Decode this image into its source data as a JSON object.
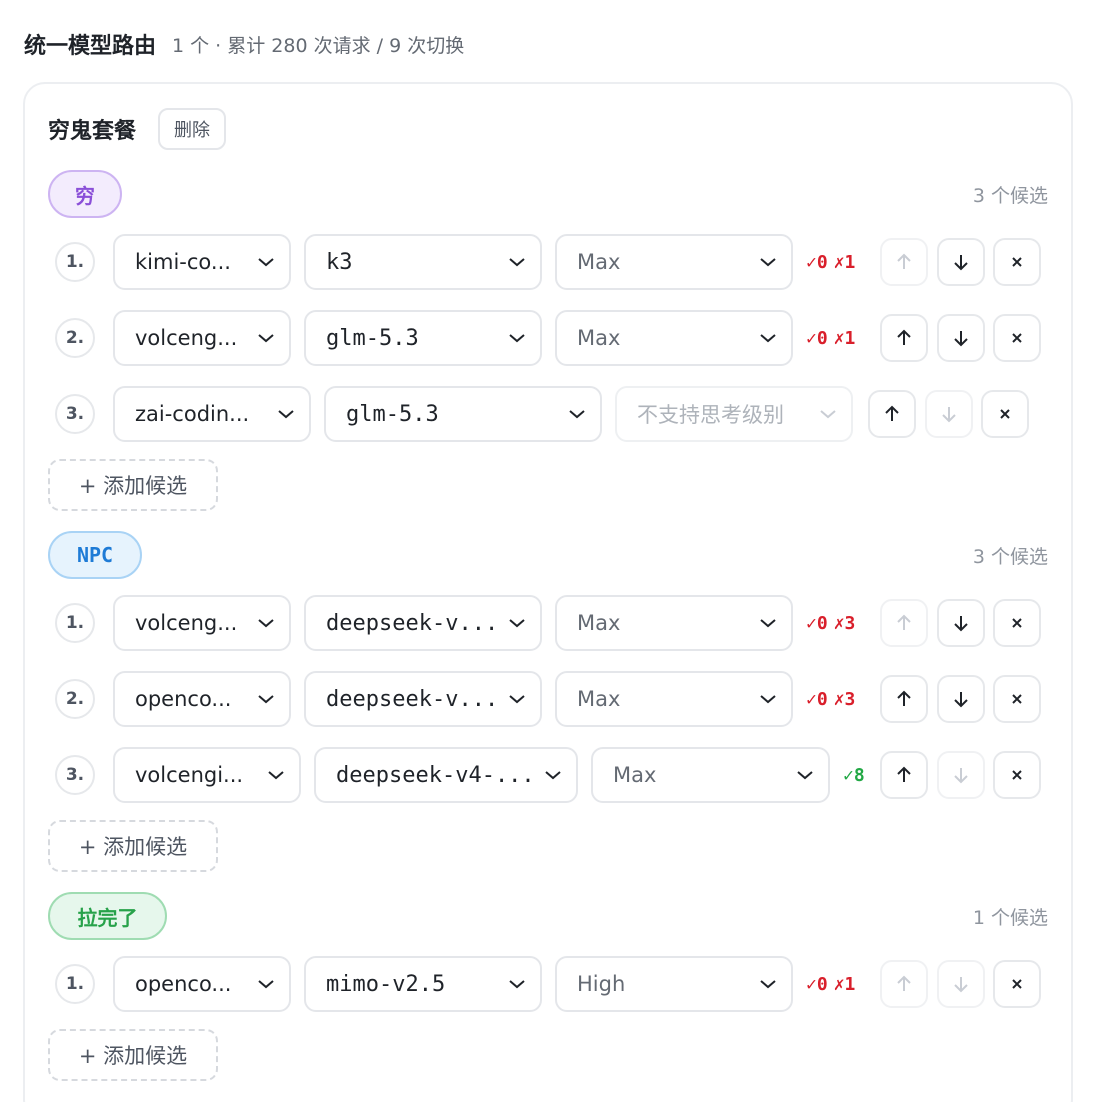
{
  "header": {
    "title": "统一模型路由",
    "stats": "1 个 · 累计 280 次请求 / 9 次切换"
  },
  "plan": {
    "name": "穷鬼套餐",
    "delete_label": "删除"
  },
  "add_label": "+ 添加候选",
  "colors": {
    "tier_purple": "#8a4fd8",
    "tier_blue": "#1e7bd6",
    "tier_green": "#27a24a",
    "ok_red": "#d91f2b",
    "ok_green": "#22a845"
  },
  "groups": [
    {
      "tier": "穷",
      "count": "3 个候选",
      "rows": [
        {
          "index": "1.",
          "provider": "kimi-co...",
          "model": "k3",
          "level": "Max",
          "ok": "✓0",
          "fail": "✗1"
        },
        {
          "index": "2.",
          "provider": "volceng...",
          "model": "glm-5.3",
          "level": "Max",
          "ok": "✓0",
          "fail": "✗1"
        },
        {
          "index": "3.",
          "provider": "zai-codin...",
          "model": "glm-5.3",
          "level": "不支持思考级别"
        }
      ]
    },
    {
      "tier": "NPC",
      "count": "3 个候选",
      "rows": [
        {
          "index": "1.",
          "provider": "volceng...",
          "model": "deepseek-v...",
          "level": "Max",
          "ok": "✓0",
          "fail": "✗3"
        },
        {
          "index": "2.",
          "provider": "openco...",
          "model": "deepseek-v...",
          "level": "Max",
          "ok": "✓0",
          "fail": "✗3"
        },
        {
          "index": "3.",
          "provider": "volcengi...",
          "model": "deepseek-v4-...",
          "level": "Max",
          "ok": "✓8"
        }
      ]
    },
    {
      "tier": "拉完了",
      "count": "1 个候选",
      "rows": [
        {
          "index": "1.",
          "provider": "openco...",
          "model": "mimo-v2.5",
          "level": "High",
          "ok": "✓0",
          "fail": "✗1"
        }
      ]
    }
  ]
}
